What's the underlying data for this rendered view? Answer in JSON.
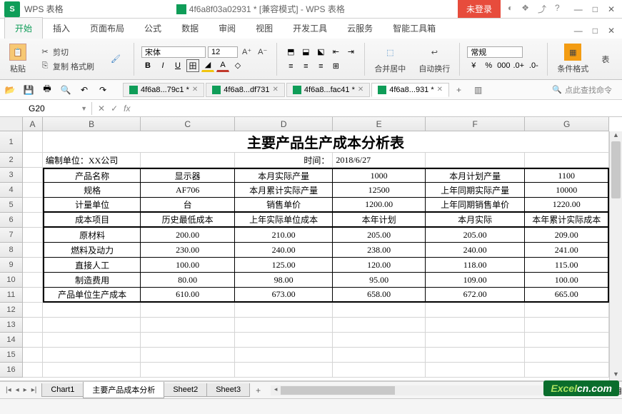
{
  "app": {
    "short": "S",
    "name": "WPS 表格"
  },
  "titlebar": {
    "doc": "4f6a8f03a02931 * [兼容模式] - WPS 表格",
    "login": "未登录"
  },
  "menus": [
    "开始",
    "插入",
    "页面布局",
    "公式",
    "数据",
    "审阅",
    "视图",
    "开发工具",
    "云服务",
    "智能工具箱"
  ],
  "ribbon": {
    "paste": "粘贴",
    "cut": "剪切",
    "copy": "复制",
    "fmtpaint": "格式刷",
    "font": "宋体",
    "size": "12",
    "merge": "合并居中",
    "wrap": "自动换行",
    "numfmt": "常规",
    "condfmt": "条件格式",
    "table": "表"
  },
  "doctabs": [
    {
      "label": "4f6a8...79c1 *",
      "active": false
    },
    {
      "label": "4f6a8...df731",
      "active": false
    },
    {
      "label": "4f6a8...fac41 *",
      "active": false
    },
    {
      "label": "4f6a8...931 *",
      "active": true
    }
  ],
  "search_hint": "点此查找命令",
  "namebox": "G20",
  "sheet": {
    "cols": [
      "A",
      "B",
      "C",
      "D",
      "E",
      "F",
      "G"
    ],
    "rows_shown": 16,
    "title": "主要产品生产成本分析表",
    "r2": {
      "b": "编制单位：XX公司",
      "d": "时间：",
      "e": "2018/6/27"
    },
    "r3": {
      "b": "产品名称",
      "c": "显示器",
      "d": "本月实际产量",
      "e": "1000",
      "f": "本月计划产量",
      "g": "1100"
    },
    "r4": {
      "b": "规格",
      "c": "AF706",
      "d": "本月累计实际产量",
      "e": "12500",
      "f": "上年同期实际产量",
      "g": "10000"
    },
    "r5": {
      "b": "计量单位",
      "c": "台",
      "d": "销售单价",
      "e": "1200.00",
      "f": "上年同期销售单价",
      "g": "1220.00"
    },
    "r6": {
      "b": "成本项目",
      "c": "历史最低成本",
      "d": "上年实际单位成本",
      "e": "本年计划",
      "f": "本月实际",
      "g": "本年累计实际成本"
    },
    "r7": {
      "b": "原材料",
      "c": "200.00",
      "d": "210.00",
      "e": "205.00",
      "f": "205.00",
      "g": "209.00"
    },
    "r8": {
      "b": "燃料及动力",
      "c": "230.00",
      "d": "240.00",
      "e": "238.00",
      "f": "240.00",
      "g": "241.00"
    },
    "r9": {
      "b": "直接人工",
      "c": "100.00",
      "d": "125.00",
      "e": "120.00",
      "f": "118.00",
      "g": "115.00"
    },
    "r10": {
      "b": "制造费用",
      "c": "80.00",
      "d": "98.00",
      "e": "95.00",
      "f": "109.00",
      "g": "100.00"
    },
    "r11": {
      "b": "产品单位生产成本",
      "c": "610.00",
      "d": "673.00",
      "e": "658.00",
      "f": "672.00",
      "g": "665.00"
    }
  },
  "sheettabs": [
    "Chart1",
    "主要产品成本分析",
    "Sheet2",
    "Sheet3"
  ],
  "sheettab_active": 1,
  "watermark": {
    "pre": "Excel",
    "suf": "cn.com"
  }
}
